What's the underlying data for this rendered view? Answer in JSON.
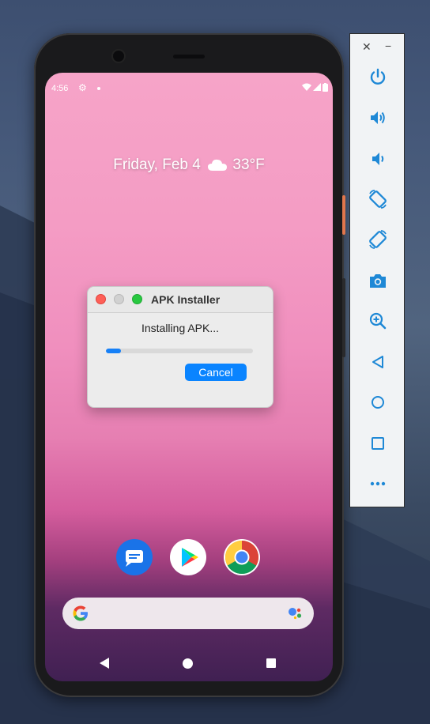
{
  "status": {
    "time": "4:56"
  },
  "home": {
    "date_weather": "Friday, Feb 4",
    "temperature": "33°F"
  },
  "dialog": {
    "title": "APK Installer",
    "message": "Installing APK...",
    "progress_fraction": 0.1,
    "cancel_label": "Cancel"
  },
  "toolbar": {
    "close_glyph": "✕",
    "minimize_glyph": "−",
    "items": [
      "power-icon",
      "volume-up-icon",
      "volume-down-icon",
      "rotate-left-icon",
      "rotate-right-icon",
      "camera-icon",
      "zoom-icon",
      "back-icon",
      "home-icon",
      "overview-icon",
      "more-icon"
    ]
  },
  "colors": {
    "accent": "#0a84ff",
    "progress": "#1680f7",
    "toolbar_icon": "#1e88d6"
  }
}
